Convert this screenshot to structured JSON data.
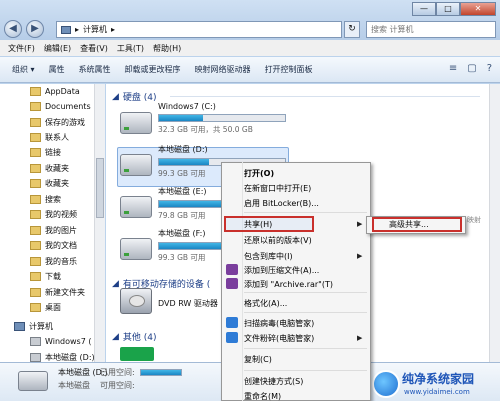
{
  "address": {
    "path_item": "计算机",
    "refresh_glyph": "↻",
    "search_placeholder": "搜索 计算机"
  },
  "window_buttons": {
    "minimize": "—",
    "maximize": "□",
    "close": "✕"
  },
  "nav_buttons": {
    "back": "◀",
    "forward": "▶"
  },
  "menubar": [
    "文件(F)",
    "编辑(E)",
    "查看(V)",
    "工具(T)",
    "帮助(H)"
  ],
  "toolbar": {
    "items": [
      "组织 ▾",
      "属性",
      "系统属性",
      "卸载或更改程序",
      "映射网络驱动器",
      "打开控制面板"
    ],
    "right_icons": [
      "≡",
      "▢",
      "?"
    ]
  },
  "nav_pane": [
    {
      "label": "AppData",
      "kind": "folder"
    },
    {
      "label": "Documents",
      "kind": "folder"
    },
    {
      "label": "保存的游戏",
      "kind": "folder"
    },
    {
      "label": "联系人",
      "kind": "folder"
    },
    {
      "label": "链接",
      "kind": "folder"
    },
    {
      "label": "收藏夹",
      "kind": "folder"
    },
    {
      "label": "收藏夹",
      "kind": "folder"
    },
    {
      "label": "搜索",
      "kind": "folder"
    },
    {
      "label": "我的视频",
      "kind": "folder"
    },
    {
      "label": "我的图片",
      "kind": "folder"
    },
    {
      "label": "我的文档",
      "kind": "folder"
    },
    {
      "label": "我的音乐",
      "kind": "folder"
    },
    {
      "label": "下载",
      "kind": "folder"
    },
    {
      "label": "新建文件夹",
      "kind": "folder"
    },
    {
      "label": "桌面",
      "kind": "folder"
    },
    {
      "label": "计算机",
      "kind": "computer"
    },
    {
      "label": "Windows7 (",
      "kind": "drive"
    },
    {
      "label": "本地磁盘 (D:)",
      "kind": "drive"
    }
  ],
  "sections": {
    "hard_disks": "硬盘 (4)",
    "removable": "有可移动存储的设备 (",
    "other": "其他 (4)"
  },
  "drives": [
    {
      "name": "Windows7 (C:)",
      "info": "32.3 GB 可用，共 50.0 GB",
      "used_fraction": 0.35
    },
    {
      "name": "本地磁盘 (D:)",
      "info": "99.3 GB 可用",
      "used_fraction": 0.4
    },
    {
      "name": "本地磁盘 (E:)",
      "info": "79.8 GB 可用",
      "used_fraction": 0.6
    },
    {
      "name": "本地磁盘 (F:)",
      "info": "99.3 GB 可用",
      "used_fraction": 0.55
    }
  ],
  "dvd_drive": "DVD RW 驱动器",
  "details": {
    "name": "本地磁盘 (D:)",
    "type": "本地磁盘",
    "used_label": "已用空间:",
    "free_label": "可用空间:"
  },
  "context_menu": {
    "items": [
      {
        "label": "打开(O)",
        "bold": true
      },
      {
        "label": "在新窗口中打开(E)"
      },
      {
        "label": "启用 BitLocker(B)..."
      },
      {
        "label": "共享(H)",
        "submenu": true
      },
      {
        "label": "还原以前的版本(V)"
      },
      {
        "label": "包含到库中(I)",
        "submenu": true
      },
      {
        "label": "添加到压缩文件(A)..."
      },
      {
        "label": "添加到 \"Archive.rar\"(T)"
      },
      {
        "label": "格式化(A)..."
      },
      {
        "label": "扫描病毒(电脑管家)"
      },
      {
        "label": "文件粉碎(电脑管家)",
        "submenu": true
      },
      {
        "label": "复制(C)"
      },
      {
        "label": "创建快捷方式(S)"
      },
      {
        "label": "重命名(M)"
      }
    ],
    "submenu_arrow": "▶"
  },
  "share_submenu": {
    "label": "高级共享..."
  },
  "background_fragment": "映射",
  "watermark": {
    "title": "纯净系统家园",
    "url": "www.yidaimei.com"
  }
}
